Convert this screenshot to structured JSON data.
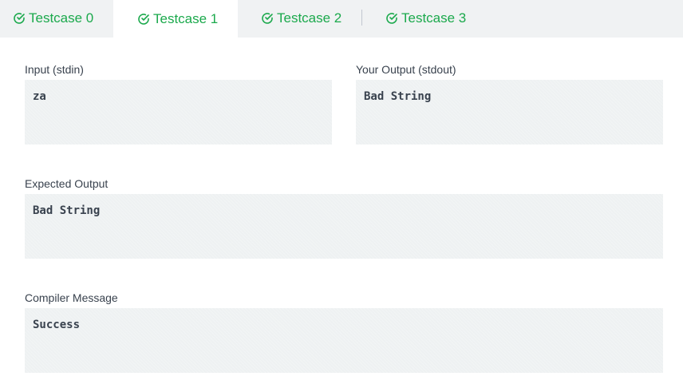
{
  "tabs": [
    {
      "label": "Testcase 0",
      "icon": "check-circle-icon",
      "active": false
    },
    {
      "label": "Testcase 1",
      "icon": "check-circle-icon",
      "active": true
    },
    {
      "label": "Testcase 2",
      "icon": "check-circle-icon",
      "active": false
    },
    {
      "label": "Testcase 3",
      "icon": "check-circle-icon",
      "active": false
    }
  ],
  "input": {
    "label": "Input (stdin)",
    "value": "za"
  },
  "your_output": {
    "label": "Your Output (stdout)",
    "value": "Bad String"
  },
  "expected_output": {
    "label": "Expected Output",
    "value": "Bad String"
  },
  "compiler_message": {
    "label": "Compiler Message",
    "value": "Success"
  },
  "colors": {
    "accent": "#1ba94c",
    "tab_bar_bg": "#f0f2f3",
    "box_bg": "#eef1f2",
    "text": "#39424e"
  }
}
